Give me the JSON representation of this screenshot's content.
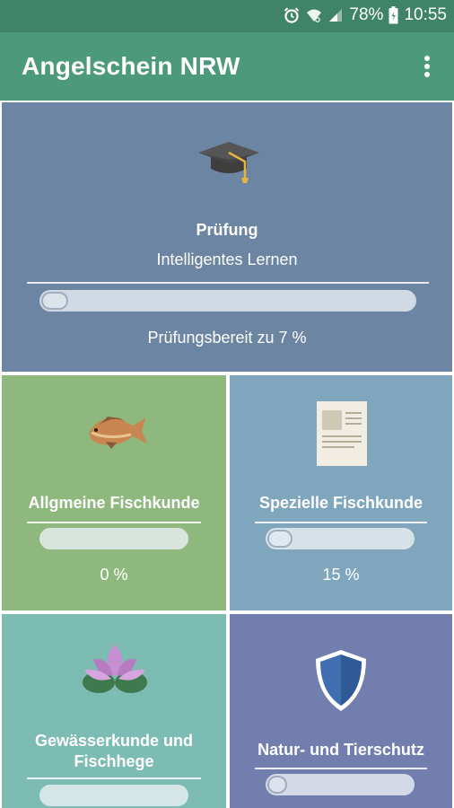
{
  "status_bar": {
    "battery_percent": "78%",
    "time": "10:55",
    "icons": [
      "alarm-icon",
      "wifi-icon",
      "signal-icon",
      "battery-icon"
    ]
  },
  "app_bar": {
    "title": "Angelschein NRW",
    "menu_icon": "more-vert-icon"
  },
  "tiles": {
    "exam": {
      "title": "Prüfung",
      "subtitle": "Intelligentes Lernen",
      "progress": 0.07,
      "status": "Prüfungsbereit zu 7 %",
      "icon": "graduation-cap-icon",
      "color": "#6b85a3"
    },
    "general_fish": {
      "title": "Allgmeine Fischkunde",
      "progress": 0.0,
      "percent": "0 %",
      "icon": "fish-icon",
      "color": "#8fb87e"
    },
    "special_fish": {
      "title": "Spezielle Fischkunde",
      "progress": 0.15,
      "percent": "15 %",
      "icon": "document-icon",
      "color": "#7fa6bd"
    },
    "waters": {
      "title_line1": "Gewässerkunde und",
      "title_line2": "Fischhege",
      "progress": 0.0,
      "icon": "lotus-icon",
      "color": "#7dbcb2"
    },
    "nature": {
      "title": "Natur- und Tierschutz",
      "progress": 0.07,
      "icon": "shield-icon",
      "color": "#727fae"
    }
  }
}
